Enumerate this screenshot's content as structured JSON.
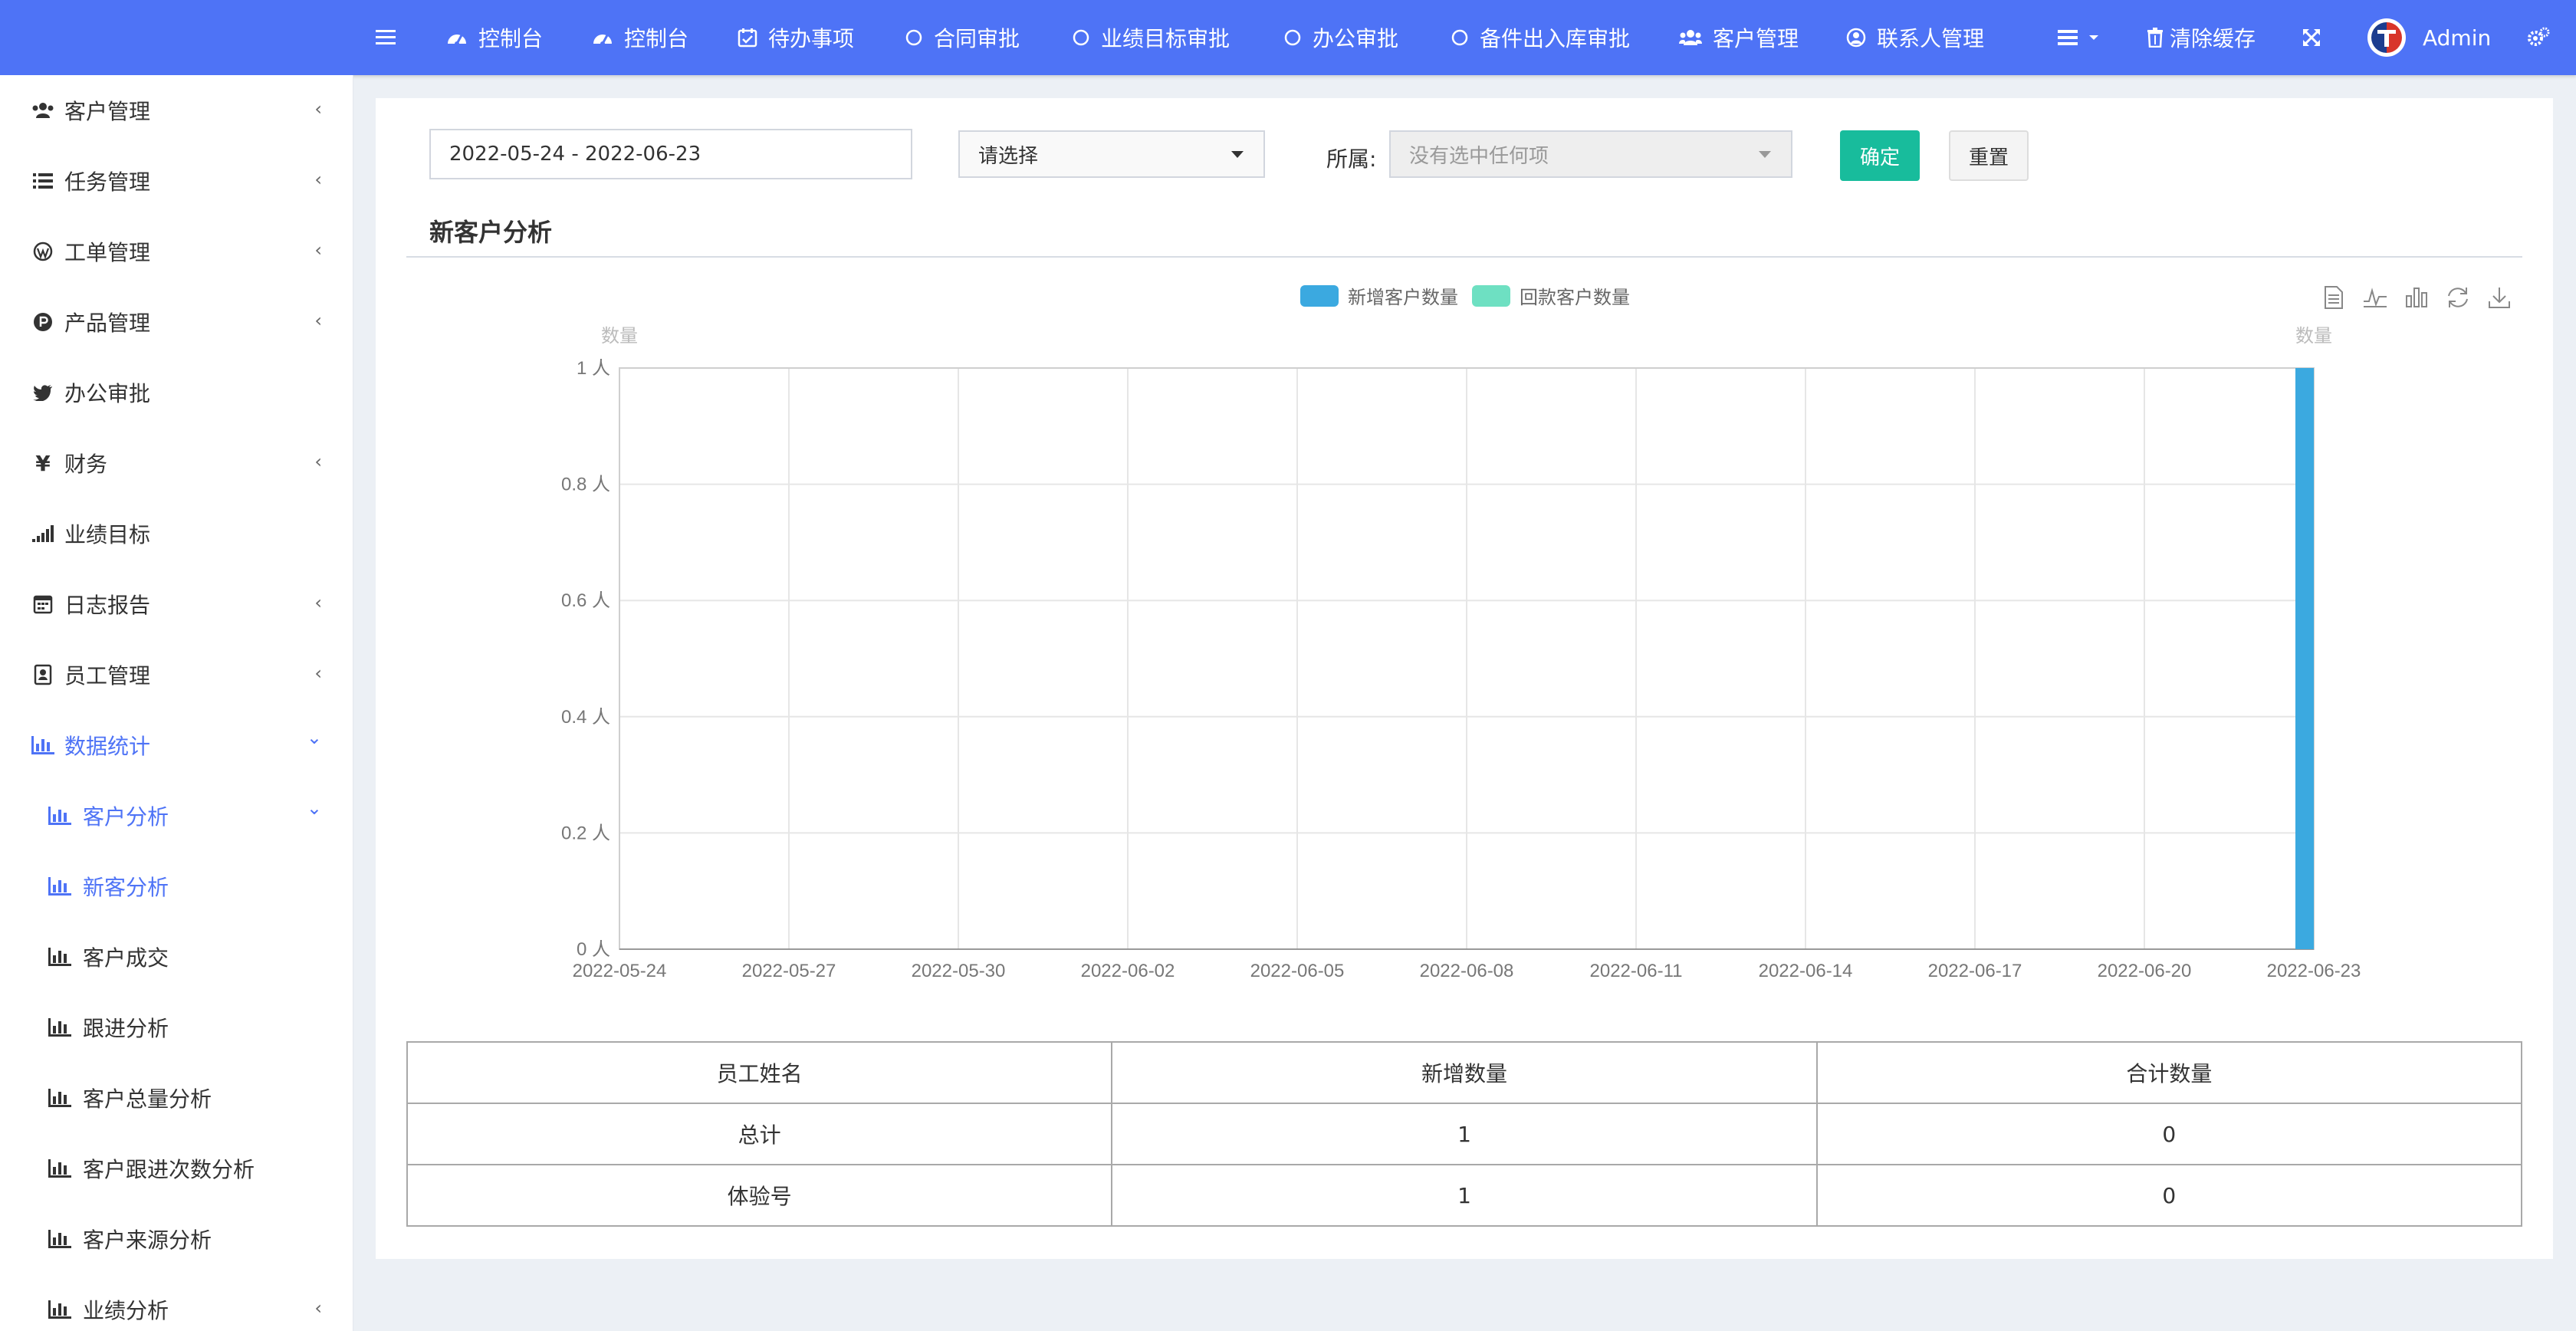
{
  "topnav": {
    "items": [
      {
        "label": "控制台",
        "icon": "dashboard-icon"
      },
      {
        "label": "控制台",
        "icon": "dashboard-icon"
      },
      {
        "label": "待办事项",
        "icon": "calendar-check-icon"
      },
      {
        "label": "合同审批",
        "icon": "circle-outline-icon"
      },
      {
        "label": "业绩目标审批",
        "icon": "circle-outline-icon"
      },
      {
        "label": "办公审批",
        "icon": "circle-outline-icon"
      },
      {
        "label": "备件出入库审批",
        "icon": "circle-outline-icon"
      },
      {
        "label": "客户管理",
        "icon": "users-icon"
      },
      {
        "label": "联系人管理",
        "icon": "user-circle-icon"
      }
    ],
    "clear_cache": "清除缓存",
    "user": "Admin"
  },
  "sidebar": {
    "items": [
      {
        "label": "客户管理",
        "icon": "users-icon",
        "arrow": "‹"
      },
      {
        "label": "任务管理",
        "icon": "list-icon",
        "arrow": "‹"
      },
      {
        "label": "工单管理",
        "icon": "wordpress-icon",
        "arrow": "‹"
      },
      {
        "label": "产品管理",
        "icon": "product-hunt-icon",
        "arrow": "‹"
      },
      {
        "label": "办公审批",
        "icon": "twitter-icon",
        "arrow": ""
      },
      {
        "label": "财务",
        "icon": "yen-icon",
        "arrow": "‹"
      },
      {
        "label": "业绩目标",
        "icon": "signal-icon",
        "arrow": ""
      },
      {
        "label": "日志报告",
        "icon": "calendar-icon",
        "arrow": "‹"
      },
      {
        "label": "员工管理",
        "icon": "id-badge-icon",
        "arrow": "‹"
      },
      {
        "label": "数据统计",
        "icon": "bar-chart-icon",
        "arrow": "⌄"
      },
      {
        "label": "客户分析",
        "icon": "bar-chart-icon",
        "arrow": "⌄"
      },
      {
        "label": "新客分析",
        "icon": "bar-chart-icon",
        "arrow": ""
      },
      {
        "label": "客户成交",
        "icon": "bar-chart-icon",
        "arrow": ""
      },
      {
        "label": "跟进分析",
        "icon": "bar-chart-icon",
        "arrow": ""
      },
      {
        "label": "客户总量分析",
        "icon": "bar-chart-icon",
        "arrow": ""
      },
      {
        "label": "客户跟进次数分析",
        "icon": "bar-chart-icon",
        "arrow": ""
      },
      {
        "label": "客户来源分析",
        "icon": "bar-chart-icon",
        "arrow": ""
      },
      {
        "label": "业绩分析",
        "icon": "bar-chart-icon",
        "arrow": "‹"
      }
    ]
  },
  "filters": {
    "date_range": "2022-05-24 - 2022-06-23",
    "select_value": "请选择",
    "owner_label": "所属:",
    "owner_placeholder": "没有选中任何项",
    "confirm": "确定",
    "reset": "重置"
  },
  "section_title": "新客户分析",
  "chart_data": {
    "type": "bar",
    "legend": [
      "新增客户数量",
      "回款客户数量"
    ],
    "colors": {
      "新增客户数量": "#3ba9e0",
      "回款客户数量": "#6ee0c2"
    },
    "y_axis_name_left": "数量",
    "y_axis_name_right": "数量",
    "y_ticks": [
      "0 人",
      "0.2 人",
      "0.4 人",
      "0.6 人",
      "0.8 人",
      "1 人"
    ],
    "ylim": [
      0,
      1
    ],
    "x_ticks": [
      "2022-05-24",
      "2022-05-27",
      "2022-05-30",
      "2022-06-02",
      "2022-06-05",
      "2022-06-08",
      "2022-06-11",
      "2022-06-14",
      "2022-06-17",
      "2022-06-20",
      "2022-06-23"
    ],
    "series": [
      {
        "name": "新增客户数量",
        "points": [
          {
            "x": "2022-06-23",
            "y": 1
          }
        ]
      },
      {
        "name": "回款客户数量",
        "points": []
      }
    ],
    "grid": true
  },
  "table": {
    "headers": [
      "员工姓名",
      "新增数量",
      "合计数量"
    ],
    "rows": [
      [
        "总计",
        "1",
        "0"
      ],
      [
        "体验号",
        "1",
        "0"
      ]
    ]
  }
}
